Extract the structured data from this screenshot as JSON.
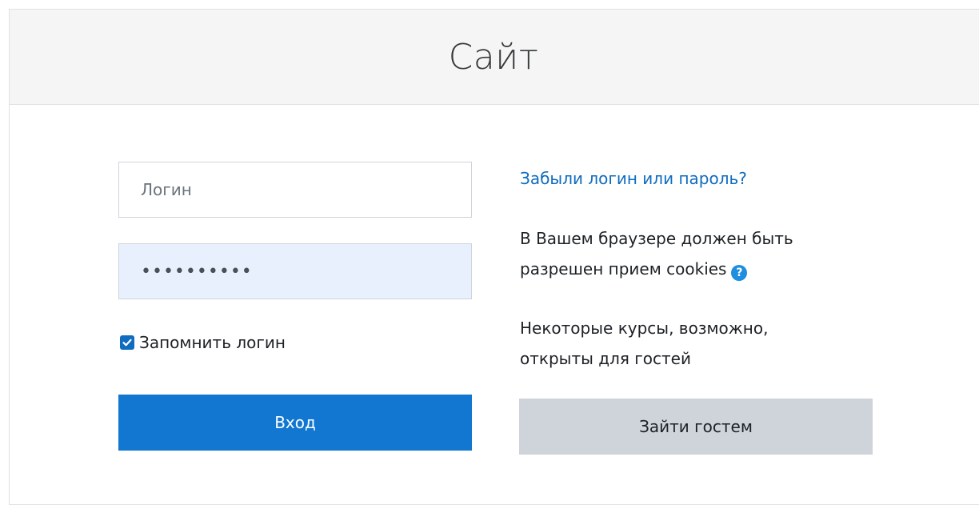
{
  "header": {
    "title": "Сайт"
  },
  "login_form": {
    "username": {
      "placeholder": "Логин",
      "value": ""
    },
    "password": {
      "value": "••••••••••"
    },
    "remember": {
      "label": "Запомнить логин",
      "checked": true
    },
    "submit_label": "Вход"
  },
  "side_panel": {
    "forgot_link": "Забыли логин или пароль?",
    "cookies_line1": "В Вашем браузере должен быть",
    "cookies_line2": "разрешен прием cookies",
    "help_icon": "?",
    "guest_line1": "Некоторые курсы, возможно,",
    "guest_line2": "открыты для гостей",
    "guest_button_label": "Зайти гостем"
  },
  "colors": {
    "primary": "#1177d1",
    "link": "#0f6cbf",
    "secondary_button": "#ced4da",
    "header_bg": "#f5f5f5",
    "autofill_bg": "#e8f0fe"
  },
  "icons": {
    "help": "question-circle-icon",
    "checkbox": "checkmark-icon"
  }
}
